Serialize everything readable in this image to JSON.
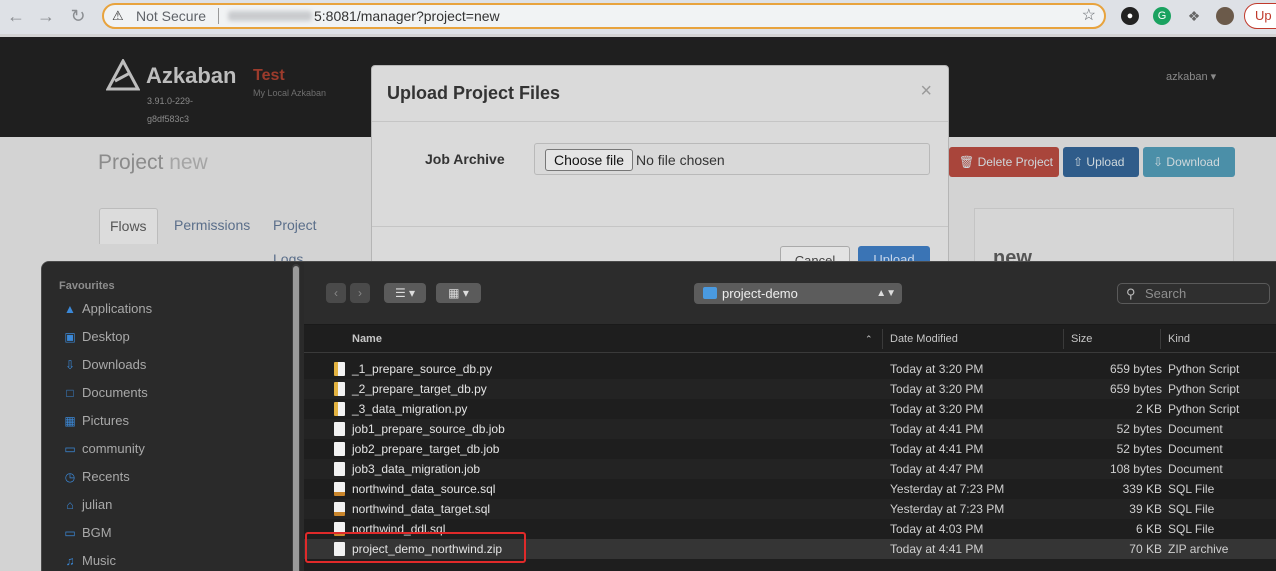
{
  "browser": {
    "security_warning": "Not Secure",
    "url_path": "5:8081/manager?project=new",
    "update_button": "Up"
  },
  "azkaban": {
    "brand": "Azkaban",
    "version": "3.91.0-229-g8df583c3",
    "env_name": "Test",
    "env_desc": "My Local Azkaban",
    "user": "azkaban",
    "page_title_prefix": "Project",
    "page_title_name": "new",
    "buttons": {
      "delete": "Delete Project",
      "upload": "Upload",
      "download": "Download"
    },
    "tabs": [
      "Flows",
      "Permissions",
      "Project Logs"
    ],
    "side_title": "new"
  },
  "modal": {
    "title": "Upload Project Files",
    "close": "×",
    "job_archive_label": "Job Archive",
    "choose_file_label": "Choose file",
    "no_file_text": "No file chosen",
    "cancel_label": "Cancel",
    "upload_label": "Upload"
  },
  "finder": {
    "sidebar_heading": "Favourites",
    "sidebar_items": [
      {
        "label": "Applications",
        "icon": "applications-icon"
      },
      {
        "label": "Desktop",
        "icon": "desktop-icon"
      },
      {
        "label": "Downloads",
        "icon": "downloads-icon"
      },
      {
        "label": "Documents",
        "icon": "documents-icon"
      },
      {
        "label": "Pictures",
        "icon": "pictures-icon"
      },
      {
        "label": "community",
        "icon": "folder-icon"
      },
      {
        "label": "Recents",
        "icon": "clock-icon"
      },
      {
        "label": "julian",
        "icon": "home-icon"
      },
      {
        "label": "BGM",
        "icon": "folder-icon"
      },
      {
        "label": "Music",
        "icon": "music-icon"
      }
    ],
    "current_folder": "project-demo",
    "search_placeholder": "Search",
    "columns": {
      "name": "Name",
      "date": "Date Modified",
      "size": "Size",
      "kind": "Kind"
    },
    "files": [
      {
        "name": "_1_prepare_source_db.py",
        "date": "Today at 3:20 PM",
        "size": "659 bytes",
        "kind": "Python Script",
        "type": "py"
      },
      {
        "name": "_2_prepare_target_db.py",
        "date": "Today at 3:20 PM",
        "size": "659 bytes",
        "kind": "Python Script",
        "type": "py"
      },
      {
        "name": "_3_data_migration.py",
        "date": "Today at 3:20 PM",
        "size": "2 KB",
        "kind": "Python Script",
        "type": "py"
      },
      {
        "name": "job1_prepare_source_db.job",
        "date": "Today at 4:41 PM",
        "size": "52 bytes",
        "kind": "Document",
        "type": "doc"
      },
      {
        "name": "job2_prepare_target_db.job",
        "date": "Today at 4:41 PM",
        "size": "52 bytes",
        "kind": "Document",
        "type": "doc"
      },
      {
        "name": "job3_data_migration.job",
        "date": "Today at 4:47 PM",
        "size": "108 bytes",
        "kind": "Document",
        "type": "doc"
      },
      {
        "name": "northwind_data_source.sql",
        "date": "Yesterday at 7:23 PM",
        "size": "339 KB",
        "kind": "SQL File",
        "type": "sql"
      },
      {
        "name": "northwind_data_target.sql",
        "date": "Yesterday at 7:23 PM",
        "size": "39 KB",
        "kind": "SQL File",
        "type": "sql"
      },
      {
        "name": "northwind_ddl.sql",
        "date": "Today at 4:03 PM",
        "size": "6 KB",
        "kind": "SQL File",
        "type": "sql"
      },
      {
        "name": "project_demo_northwind.zip",
        "date": "Today at 4:41 PM",
        "size": "70 KB",
        "kind": "ZIP archive",
        "type": "zip"
      }
    ],
    "highlight_color": "#e02a2a"
  }
}
